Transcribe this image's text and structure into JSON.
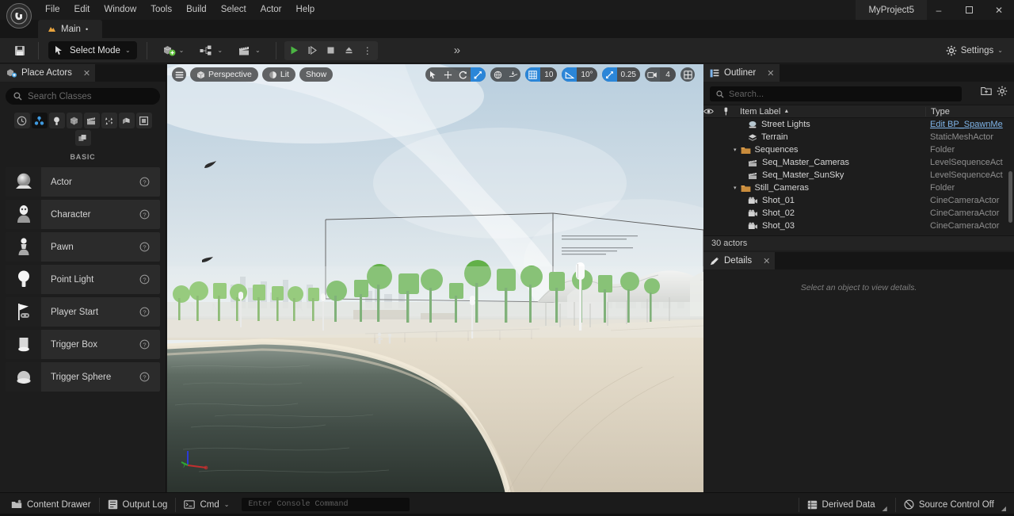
{
  "window": {
    "project_title": "MyProject5",
    "minimize_label": "–",
    "maximize_label": "☐",
    "close_label": "✕"
  },
  "menubar": {
    "items": [
      "File",
      "Edit",
      "Window",
      "Tools",
      "Build",
      "Select",
      "Actor",
      "Help"
    ]
  },
  "level_tab": {
    "label": "Main",
    "dirty_marker": "•",
    "icon": "level-icon"
  },
  "toolbar": {
    "save_icon": "save-icon",
    "mode_label": "Select Mode",
    "mode_caret": "⌄",
    "add_actor_icon": "add-actor-icon",
    "blueprints_icon": "blueprints-icon",
    "cinematics_icon": "cinematics-icon",
    "play_label": "Play",
    "step_label": "Step",
    "stop_label": "Stop",
    "eject_label": "Eject",
    "more_label": "⋮",
    "expand_chevrons": "»",
    "settings_label": "Settings",
    "settings_caret": "⌄"
  },
  "place_actors": {
    "tab_label": "Place Actors",
    "close_label": "✕",
    "search_placeholder": "Search Classes",
    "categories": [
      {
        "name": "recently-placed",
        "active": false
      },
      {
        "name": "basic",
        "active": true
      },
      {
        "name": "lights",
        "active": false
      },
      {
        "name": "shapes",
        "active": false
      },
      {
        "name": "cinematic",
        "active": false
      },
      {
        "name": "visual-effects",
        "active": false
      },
      {
        "name": "geometry",
        "active": false
      },
      {
        "name": "volumes",
        "active": false
      },
      {
        "name": "all-classes",
        "active": false
      }
    ],
    "section_label": "BASIC",
    "help_glyph": "?",
    "items": [
      {
        "label": "Actor",
        "icon": "actor-sphere-icon"
      },
      {
        "label": "Character",
        "icon": "character-icon"
      },
      {
        "label": "Pawn",
        "icon": "pawn-icon"
      },
      {
        "label": "Point Light",
        "icon": "point-light-icon"
      },
      {
        "label": "Player Start",
        "icon": "player-start-icon"
      },
      {
        "label": "Trigger Box",
        "icon": "trigger-box-icon"
      },
      {
        "label": "Trigger Sphere",
        "icon": "trigger-sphere-icon"
      }
    ]
  },
  "viewport": {
    "menu_icon": "viewport-menu-icon",
    "camera_mode": "Perspective",
    "view_mode": "Lit",
    "show_label": "Show",
    "transform_tools": [
      {
        "name": "select-tool",
        "active": false
      },
      {
        "name": "translate-tool",
        "active": false
      },
      {
        "name": "rotate-tool",
        "active": false
      },
      {
        "name": "scale-tool",
        "active": true
      }
    ],
    "coord_tools": [
      {
        "name": "world-coordinate-toggle",
        "active": false
      },
      {
        "name": "surface-snap-toggle",
        "active": false
      }
    ],
    "grid_snap": {
      "enabled": true,
      "value": "10",
      "icon": "grid-snap-icon"
    },
    "rotation_snap": {
      "enabled": true,
      "value": "10°",
      "icon": "angle-snap-icon"
    },
    "scale_snap": {
      "enabled": true,
      "value": "0.25",
      "icon": "scale-snap-icon"
    },
    "camera_speed": {
      "value": "4",
      "icon": "camera-speed-icon"
    },
    "maximize_icon": "viewport-layout-icon",
    "gizmo_axes": [
      "x",
      "y",
      "z"
    ]
  },
  "outliner": {
    "tab_label": "Outliner",
    "close_label": "✕",
    "search_placeholder": "Search...",
    "add_folder_icon": "add-folder-icon",
    "settings_icon": "gear-icon",
    "columns": {
      "label": "Item Label",
      "sort_arrow": "▲",
      "type": "Type"
    },
    "footer": "30 actors",
    "rows": [
      {
        "label": "Street Lights",
        "type": "Edit BP_SpawnMe",
        "type_link": true,
        "indent": 2,
        "icon": "blueprint-actor-icon",
        "expander": ""
      },
      {
        "label": "Terrain",
        "type": "StaticMeshActor",
        "type_link": false,
        "indent": 2,
        "icon": "static-mesh-icon",
        "expander": ""
      },
      {
        "label": "Sequences",
        "type": "Folder",
        "type_link": false,
        "indent": 1,
        "icon": "folder-icon",
        "expander": "▾"
      },
      {
        "label": "Seq_Master_Cameras",
        "type": "LevelSequenceAct",
        "type_link": false,
        "indent": 2,
        "icon": "sequence-icon",
        "expander": ""
      },
      {
        "label": "Seq_Master_SunSky",
        "type": "LevelSequenceAct",
        "type_link": false,
        "indent": 2,
        "icon": "sequence-icon",
        "expander": ""
      },
      {
        "label": "Still_Cameras",
        "type": "Folder",
        "type_link": false,
        "indent": 1,
        "icon": "folder-icon",
        "expander": "▾"
      },
      {
        "label": "Shot_01",
        "type": "CineCameraActor",
        "type_link": false,
        "indent": 2,
        "icon": "cine-camera-icon",
        "expander": ""
      },
      {
        "label": "Shot_02",
        "type": "CineCameraActor",
        "type_link": false,
        "indent": 2,
        "icon": "cine-camera-icon",
        "expander": ""
      },
      {
        "label": "Shot_03",
        "type": "CineCameraActor",
        "type_link": false,
        "indent": 2,
        "icon": "cine-camera-icon",
        "expander": ""
      }
    ]
  },
  "details": {
    "tab_label": "Details",
    "close_label": "✕",
    "empty_message": "Select an object to view details."
  },
  "statusbar": {
    "content_drawer": "Content Drawer",
    "output_log": "Output Log",
    "cmd_label": "Cmd",
    "cmd_caret": "⌄",
    "console_placeholder": "Enter Console Command",
    "derived_data": "Derived Data",
    "source_control": "Source Control Off"
  },
  "colors": {
    "accent_blue": "#2b86d8",
    "play_green": "#4bb543",
    "panel_bg": "#1d1d1d",
    "toolbar_bg": "#242424",
    "link_blue": "#7fb4e8",
    "folder_orange": "#c98c3c"
  }
}
